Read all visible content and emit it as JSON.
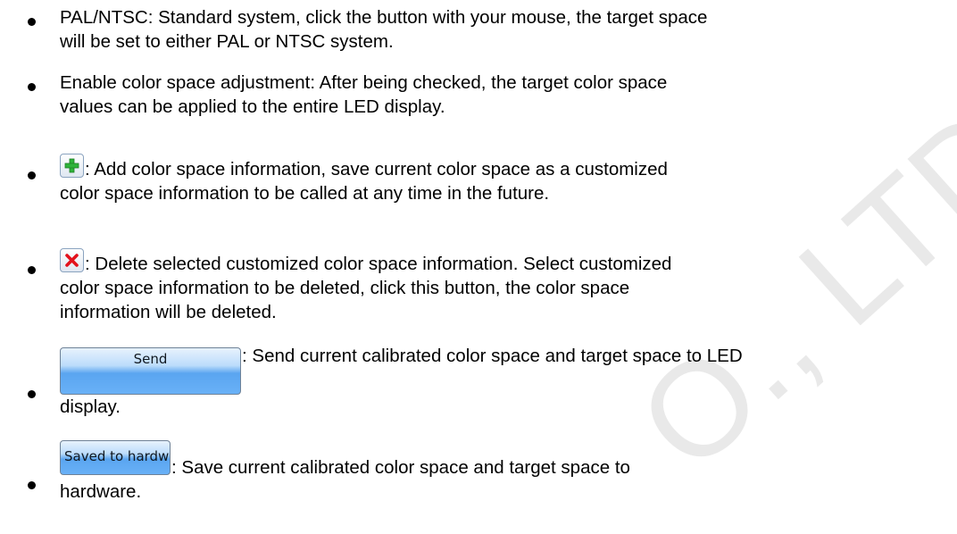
{
  "watermark": "O., LTD",
  "items": [
    {
      "lines": [
        "PAL/NTSC: Standard system, click the button with your mouse, the target space",
        "will be set to either PAL or NTSC system."
      ]
    },
    {
      "lines": [
        "Enable color space adjustment: After being checked, the target color space",
        "values can be applied to the entire LED display."
      ]
    },
    {
      "icon": "add-icon",
      "lines": [
        ": Add color space information, save current color space as a customized",
        "color space information to be called at any time in the future."
      ]
    },
    {
      "icon": "delete-icon",
      "lines": [
        ": Delete selected customized color space information. Select customized",
        "color space information to be deleted, click this button, the color space",
        "information will be deleted."
      ]
    },
    {
      "button_label": "Send",
      "lines": [
        ": Send current calibrated color space and target space to LED",
        "display."
      ]
    },
    {
      "button_label": "Saved to hardwa..",
      "lines": [
        ": Save current calibrated color space and target space to",
        "hardware."
      ]
    }
  ],
  "colors": {
    "add_icon": "#2fb33a",
    "delete_icon": "#e3121c",
    "button_blue": "#5aa5f0"
  }
}
